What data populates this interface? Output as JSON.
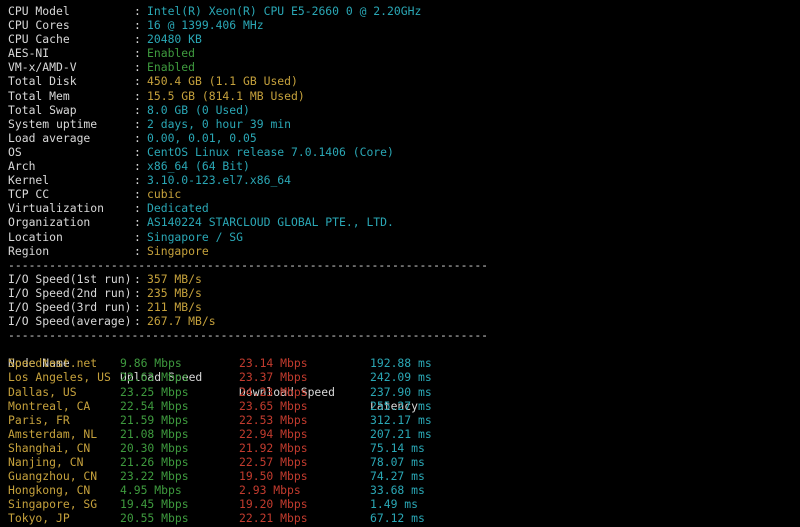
{
  "colors": {
    "background": "#000000",
    "label": "#d8d8d8",
    "cyan": "#2aa7b5",
    "green": "#3e9a3e",
    "yellow": "#c5a13c",
    "red": "#c23b2e"
  },
  "sysinfo": [
    {
      "key": "CPU Model",
      "value": "Intel(R) Xeon(R) CPU E5-2660 0 @ 2.20GHz",
      "color": "cyan"
    },
    {
      "key": "CPU Cores",
      "value": "16 @ 1399.406 MHz",
      "color": "cyan"
    },
    {
      "key": "CPU Cache",
      "value": "20480 KB",
      "color": "cyan"
    },
    {
      "key": "AES-NI",
      "value": "Enabled",
      "color": "green"
    },
    {
      "key": "VM-x/AMD-V",
      "value": "Enabled",
      "color": "green"
    },
    {
      "key": "Total Disk",
      "value": "450.4 GB (1.1 GB Used)",
      "color": "yellow"
    },
    {
      "key": "Total Mem",
      "value": "15.5 GB (814.1 MB Used)",
      "color": "yellow"
    },
    {
      "key": "Total Swap",
      "value": "8.0 GB (0 Used)",
      "color": "cyan"
    },
    {
      "key": "System uptime",
      "value": "2 days, 0 hour 39 min",
      "color": "cyan"
    },
    {
      "key": "Load average",
      "value": "0.00, 0.01, 0.05",
      "color": "cyan"
    },
    {
      "key": "OS",
      "value": "CentOS Linux release 7.0.1406 (Core)",
      "color": "cyan"
    },
    {
      "key": "Arch",
      "value": "x86_64 (64 Bit)",
      "color": "cyan"
    },
    {
      "key": "Kernel",
      "value": "3.10.0-123.el7.x86_64",
      "color": "cyan"
    },
    {
      "key": "TCP CC",
      "value": "cubic",
      "color": "yellow"
    },
    {
      "key": "Virtualization",
      "value": "Dedicated",
      "color": "cyan"
    },
    {
      "key": "Organization",
      "value": "AS140224 STARCLOUD GLOBAL PTE., LTD.",
      "color": "cyan"
    },
    {
      "key": "Location",
      "value": "Singapore / SG",
      "color": "cyan"
    },
    {
      "key": "Region",
      "value": "Singapore",
      "color": "yellow"
    }
  ],
  "separator": "----------------------------------------------------------------------",
  "separator_colon": ":",
  "io": [
    {
      "key": "I/O Speed(1st run)",
      "value": "357 MB/s"
    },
    {
      "key": "I/O Speed(2nd run)",
      "value": "235 MB/s"
    },
    {
      "key": "I/O Speed(3rd run)",
      "value": "211 MB/s"
    },
    {
      "key": "I/O Speed(average)",
      "value": "267.7 MB/s"
    }
  ],
  "speed_table": {
    "headers": [
      "Node Name",
      "Upload Speed",
      "Download Speed",
      "Latency"
    ],
    "rows": [
      [
        "Speedtest.net",
        "9.86 Mbps",
        "23.14 Mbps",
        "192.88 ms"
      ],
      [
        "Los Angeles, US",
        "22.63 Mbps",
        "23.37 Mbps",
        "242.09 ms"
      ],
      [
        "Dallas, US",
        "23.25 Mbps",
        "24.23 Mbps",
        "237.90 ms"
      ],
      [
        "Montreal, CA",
        "22.54 Mbps",
        "23.65 Mbps",
        "255.27 ms"
      ],
      [
        "Paris, FR",
        "21.59 Mbps",
        "22.53 Mbps",
        "312.17 ms"
      ],
      [
        "Amsterdam, NL",
        "21.08 Mbps",
        "22.94 Mbps",
        "207.21 ms"
      ],
      [
        "Shanghai, CN",
        "20.30 Mbps",
        "21.92 Mbps",
        "75.14 ms"
      ],
      [
        "Nanjing, CN",
        "21.26 Mbps",
        "22.57 Mbps",
        "78.07 ms"
      ],
      [
        "Guangzhou, CN",
        "23.22 Mbps",
        "19.50 Mbps",
        "74.27 ms"
      ],
      [
        "Hongkong, CN",
        "4.95 Mbps",
        "2.93 Mbps",
        "33.68 ms"
      ],
      [
        "Singapore, SG",
        "19.45 Mbps",
        "19.20 Mbps",
        "1.49 ms"
      ],
      [
        "Tokyo, JP",
        "20.55 Mbps",
        "22.21 Mbps",
        "67.12 ms"
      ]
    ]
  }
}
